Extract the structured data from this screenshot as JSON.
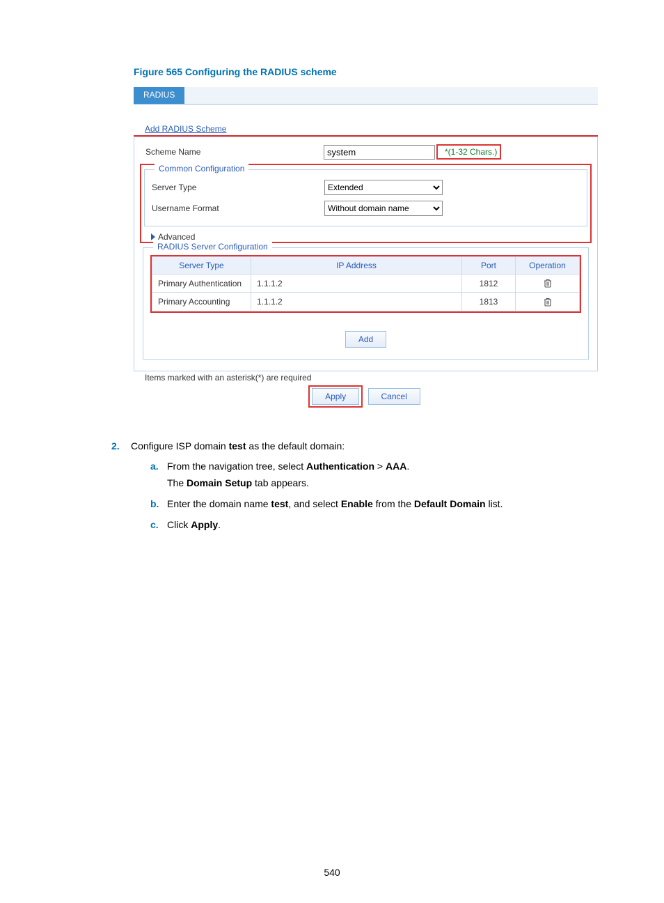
{
  "figure": {
    "label": "Figure 565 Configuring the RADIUS scheme"
  },
  "tab": {
    "label": "RADIUS"
  },
  "link": {
    "add_scheme": "Add RADIUS Scheme"
  },
  "scheme": {
    "name_label": "Scheme Name",
    "name_value": "system",
    "name_hint": "*(1-32 Chars.)"
  },
  "common": {
    "legend": "Common Configuration",
    "server_type_label": "Server Type",
    "server_type_value": "Extended",
    "username_format_label": "Username Format",
    "username_format_value": "Without domain name",
    "advanced_label": "Advanced"
  },
  "servers": {
    "legend": "RADIUS Server Configuration",
    "headers": {
      "type": "Server Type",
      "ip": "IP Address",
      "port": "Port",
      "op": "Operation"
    },
    "rows": [
      {
        "type": "Primary Authentication",
        "ip": "1.1.1.2",
        "port": "1812"
      },
      {
        "type": "Primary Accounting",
        "ip": "1.1.1.2",
        "port": "1813"
      }
    ],
    "add_label": "Add"
  },
  "footer": {
    "required_note": "Items marked with an asterisk(*) are required",
    "apply_label": "Apply",
    "cancel_label": "Cancel"
  },
  "doc": {
    "step_num": "2.",
    "step_text_pre": "Configure ISP domain ",
    "step_bold": "test",
    "step_text_post": " as the default domain:",
    "a": {
      "let": "a.",
      "line1_pre": "From the navigation tree, select ",
      "line1_b1": "Authentication",
      "line1_gt": " > ",
      "line1_b2": "AAA",
      "line1_post": ".",
      "line2_pre": "The ",
      "line2_b": "Domain Setup",
      "line2_post": " tab appears."
    },
    "b": {
      "let": "b.",
      "pre": "Enter the domain name ",
      "b1": "test",
      "mid1": ", and select ",
      "b2": "Enable",
      "mid2": " from the ",
      "b3": "Default Domain",
      "post": " list."
    },
    "c": {
      "let": "c.",
      "pre": "Click ",
      "b": "Apply",
      "post": "."
    }
  },
  "page_number": "540"
}
